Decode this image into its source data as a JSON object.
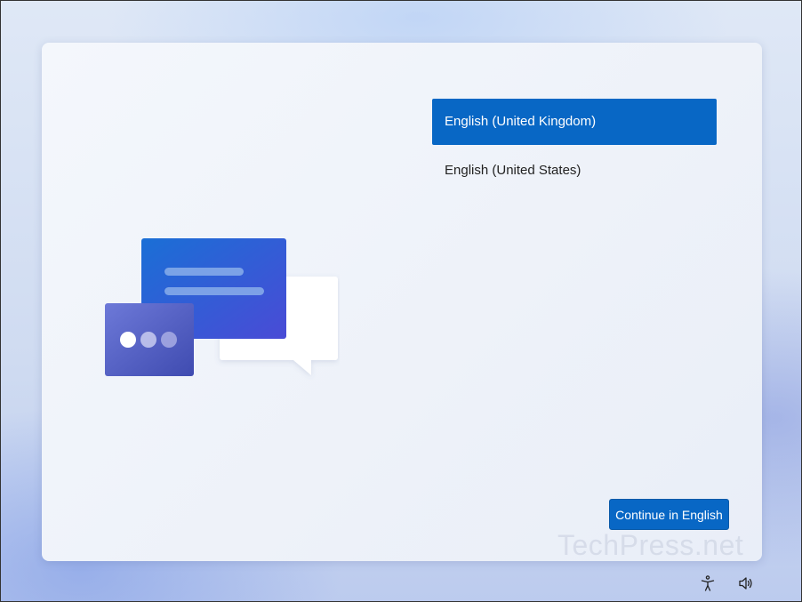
{
  "languages": {
    "items": [
      {
        "label": "English (United Kingdom)",
        "selected": true
      },
      {
        "label": "English (United States)",
        "selected": false
      }
    ]
  },
  "actions": {
    "continue_label": "Continue in English"
  },
  "watermark": "TechPress.net",
  "tray": {
    "accessibility_icon": "accessibility-icon",
    "volume_icon": "volume-icon"
  },
  "colors": {
    "accent": "#0867c5"
  }
}
